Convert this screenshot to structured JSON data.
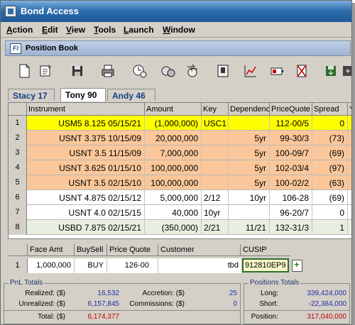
{
  "window": {
    "title": "Bond Access"
  },
  "menu": [
    "Action",
    "Edit",
    "View",
    "Tools",
    "Launch",
    "Window"
  ],
  "child_window": {
    "icon_text": "Fi",
    "title": "Position Book"
  },
  "toolbar_icons": [
    "new-document-icon",
    "refresh-icon",
    "save-icon",
    "print-icon",
    "money-clock-icon",
    "money-bags-icon",
    "money-transfer-icon",
    "ledger-icon",
    "chart-icon",
    "battery-icon",
    "erase-icon",
    "export-icon",
    "export-icon-2"
  ],
  "tabs": [
    {
      "label": "Stacy 17",
      "active": false
    },
    {
      "label": "Tony 90",
      "active": true
    },
    {
      "label": "Andy 46",
      "active": false
    }
  ],
  "grid": {
    "headers": [
      "",
      "Instrument",
      "Amount",
      "Key",
      "Dependenc",
      "PriceQuote",
      "Spread",
      "Y"
    ],
    "rows": [
      {
        "n": "1",
        "instrument": "USM5 8.125 05/15/21",
        "amount": "(1,000,000)",
        "key": "USC1",
        "dep": "",
        "price": "112-00/5",
        "spread": "0",
        "color": "#ffff00"
      },
      {
        "n": "2",
        "instrument": "USNT 3.375 10/15/09",
        "amount": "20,000,000",
        "key": "",
        "dep": "5yr",
        "price": "99-30/3",
        "spread": "(73)",
        "color": "#fbc79a"
      },
      {
        "n": "3",
        "instrument": "USNT 3.5 11/15/09",
        "amount": "7,000,000",
        "key": "",
        "dep": "5yr",
        "price": "100-09/7",
        "spread": "(69)",
        "color": "#fbc79a"
      },
      {
        "n": "4",
        "instrument": "USNT 3.625 01/15/10",
        "amount": "100,000,000",
        "key": "",
        "dep": "5yr",
        "price": "102-03/4",
        "spread": "(97)",
        "color": "#fbc79a"
      },
      {
        "n": "5",
        "instrument": "USNT 3.5 02/15/10",
        "amount": "100,000,000",
        "key": "",
        "dep": "5yr",
        "price": "100-02/2",
        "spread": "(63)",
        "color": "#fbc79a"
      },
      {
        "n": "6",
        "instrument": "USNT 4.875 02/15/12",
        "amount": "5,000,000",
        "key": "2/12",
        "dep": "10yr",
        "price": "106-28",
        "spread": "(69)",
        "color": "#ffffff"
      },
      {
        "n": "7",
        "instrument": "USNT 4.0 02/15/15",
        "amount": "40,000",
        "key": "10yr",
        "dep": "",
        "price": "96-20/7",
        "spread": "0",
        "color": "#ffffff"
      },
      {
        "n": "8",
        "instrument": "USBD 7.875 02/15/21",
        "amount": "(350,000)",
        "key": "2/21",
        "dep": "11/21",
        "price": "132-31/3",
        "spread": "1",
        "color": "#e9efe0"
      }
    ]
  },
  "entry": {
    "headers": [
      "Face Amt",
      "BuySell",
      "Price Quote",
      "Customer",
      "CUSIP"
    ],
    "row": {
      "n": "1",
      "face_amt": "1,000,000",
      "buysell": "BUY",
      "price_quote": "126-00",
      "customer": "tbd",
      "cusip": "912810EP9"
    }
  },
  "pnl": {
    "legend": "PnL Totals",
    "realized_label": "Realized: ($)",
    "realized": "16,532",
    "unrealized_label": "Unrealized: ($)",
    "unrealized": "6,157,845",
    "accretion_label": "Accretion: ($)",
    "accretion": "25",
    "commissions_label": "Commissions: ($)",
    "commissions": "0",
    "total_label": "Total: ($)",
    "total": "6,174,377"
  },
  "positions": {
    "legend": "Positions Totals",
    "long_label": "Long:",
    "long": "339,424,000",
    "short_label": "Short:",
    "short": "-22,384,000",
    "position_label": "Position:",
    "position": "317,040,000"
  },
  "colors": {
    "title_bar": "#1c5897",
    "row_yellow": "#ffff00",
    "row_orange": "#fbc79a",
    "cusip_border": "#2d6f2d",
    "negative": "#c40000"
  }
}
